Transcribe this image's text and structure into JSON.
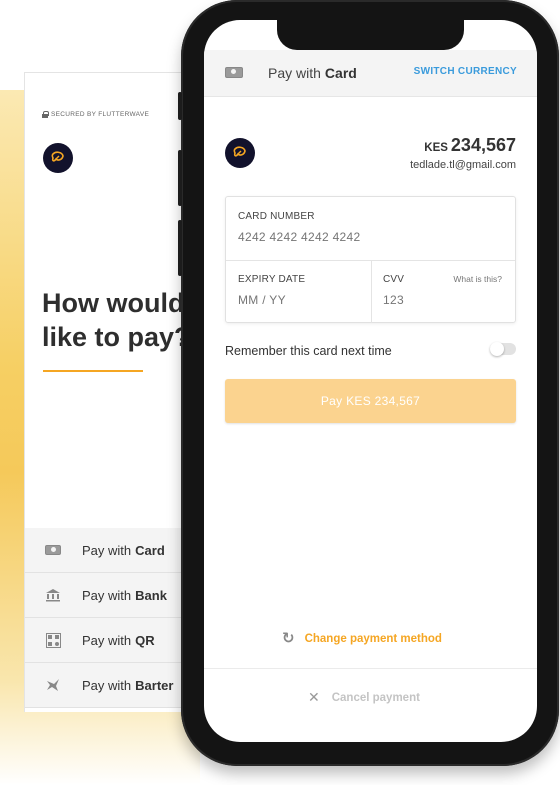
{
  "background": {
    "secured_label": "SECURED BY FLUTTERWAVE",
    "headline_line1": "How would",
    "headline_line2": "like to pay?",
    "methods": [
      {
        "prefix": "Pay with",
        "name": "Card",
        "icon": "cash-icon"
      },
      {
        "prefix": "Pay with",
        "name": "Bank",
        "icon": "bank-icon"
      },
      {
        "prefix": "Pay with",
        "name": "QR",
        "icon": "qr-icon"
      },
      {
        "prefix": "Pay with",
        "name": "Barter",
        "icon": "barter-icon"
      }
    ]
  },
  "header": {
    "title_prefix": "Pay with",
    "title_method": "Card",
    "switch_currency": "SWITCH CURRENCY"
  },
  "payment": {
    "currency": "KES",
    "amount": "234,567",
    "email": "tedlade.tl@gmail.com"
  },
  "card_form": {
    "card_number_label": "CARD NUMBER",
    "card_number_placeholder": "4242 4242 4242 4242",
    "expiry_label": "EXPIRY DATE",
    "expiry_placeholder": "MM / YY",
    "cvv_label": "CVV",
    "cvv_placeholder": "123",
    "cvv_help": "What is this?"
  },
  "remember": {
    "label": "Remember this card next time",
    "enabled": false
  },
  "pay_button": "Pay KES 234,567",
  "change_method": "Change payment method",
  "cancel": "Cancel payment",
  "colors": {
    "accent": "#f5a623",
    "link": "#3a9bdc",
    "brand_dark": "#12122c",
    "button_disabled": "#fbd38f"
  }
}
